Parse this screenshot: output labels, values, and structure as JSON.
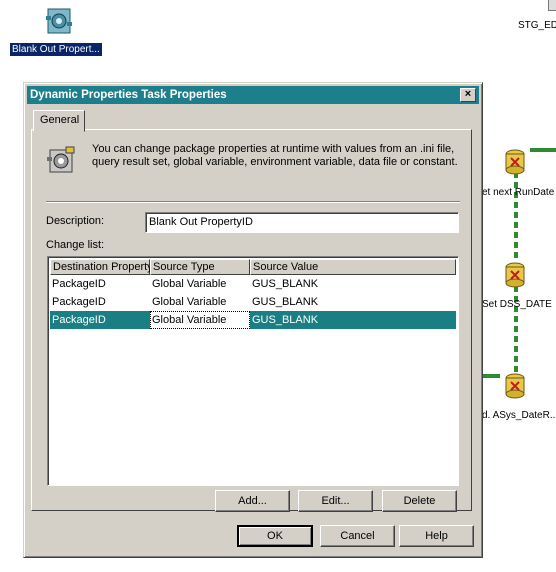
{
  "desktop": {
    "task_label": "Blank Out Propert...",
    "stg_label": "STG_ED",
    "steps": [
      {
        "label": "et next RunDate"
      },
      {
        "label": "Set DSS_DATE"
      },
      {
        "label": "d. ASys_DateR..."
      }
    ]
  },
  "dialog": {
    "title": "Dynamic Properties Task Properties",
    "close_glyph": "×",
    "tab_general": "General",
    "info_text": "You can change package properties at runtime with values from an .ini file, query result set, global variable, environment variable, data file or constant.",
    "description_label": "Description:",
    "description_value": "Blank Out PropertyID",
    "change_list_label": "Change list:",
    "columns": [
      "Destination Property",
      "Source Type",
      "Source Value"
    ],
    "rows": [
      {
        "dest": "PackageID",
        "type": "Global Variable",
        "value": "GUS_BLANK"
      },
      {
        "dest": "PackageID",
        "type": "Global Variable",
        "value": "GUS_BLANK"
      },
      {
        "dest": "PackageID",
        "type": "Global Variable",
        "value": "GUS_BLANK"
      }
    ],
    "selected_row": 2,
    "buttons": {
      "add": "Add...",
      "edit": "Edit...",
      "delete": "Delete",
      "ok": "OK",
      "cancel": "Cancel",
      "help": "Help"
    }
  }
}
